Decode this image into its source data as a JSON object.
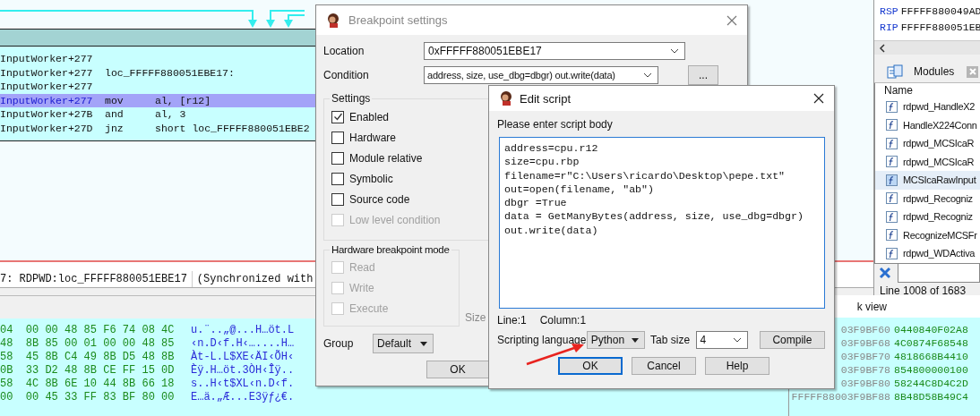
{
  "code_view": {
    "lines": [
      {
        "kind": "blank",
        "address": "InputWorker+277",
        "selected": false
      },
      {
        "kind": "label",
        "address": "InputWorker+277",
        "label": "loc_FFFFF880051EBE17:",
        "selected": false
      },
      {
        "kind": "blank",
        "address": "InputWorker+277",
        "selected": false
      },
      {
        "kind": "instruction",
        "address": "InputWorker+277",
        "mnemonic": "mov",
        "operands": "al, [r12]",
        "selected": true
      },
      {
        "kind": "instruction",
        "address": "InputWorker+27B",
        "mnemonic": "and",
        "operands": "al, 3",
        "selected": false
      },
      {
        "kind": "instruction",
        "address": "InputWorker+27D",
        "mnemonic": "jnz",
        "operands": "short loc_FFFFF880051EBE2",
        "selected": false
      }
    ],
    "status": "7: RDPWD:loc_FFFFF880051EBE17",
    "sync": "(Synchronized with"
  },
  "hex_dump": {
    "rows": [
      {
        "bytes": "04  00 00 48 85 F6 74 08 4C",
        "ascii": "u.¨..„@...H…öt.L"
      },
      {
        "bytes": "48  8B 85 00 01 00 00 48 85",
        "ascii": "‹n.D‹f.H‹…....H…"
      },
      {
        "bytes": "58  45 8B C4 49 8B D5 48 8B",
        "ascii": "Àt-L.L$XE‹ÄI‹ÕH‹"
      },
      {
        "bytes": "0B  33 D2 48 8B CE FF 15 0D",
        "ascii": "Èÿ.H…öt.3ÒH‹Îÿ.."
      },
      {
        "bytes": "58  4C 8B 6E 10 44 8B 66 18",
        "ascii": "s..H‹t$XL‹n.D‹f."
      },
      {
        "bytes": "00  00 45 33 FF 83 BF 80 00",
        "ascii": "E…ä.„Æ...E3ÿƒ¿€."
      }
    ]
  },
  "registers": [
    {
      "name": "RSP",
      "value": "FFFFF880049AD"
    },
    {
      "name": "RIP",
      "value": "FFFFF880051EB"
    }
  ],
  "modules": {
    "tab": "Modules",
    "header": "Name",
    "items": [
      {
        "name": "rdpwd_HandleX2",
        "selected": false
      },
      {
        "name": "HandleX224Conn",
        "selected": false
      },
      {
        "name": "rdpwd_MCSIcaR",
        "selected": false
      },
      {
        "name": "rdpwd_MCSIcaR",
        "selected": false
      },
      {
        "name": "MCSIcaRawInput",
        "selected": true
      },
      {
        "name": "rdpwd_Recogniz",
        "selected": false
      },
      {
        "name": "rdpwd_Recogniz",
        "selected": false
      },
      {
        "name": "RecognizeMCSFr",
        "selected": false
      },
      {
        "name": "rdpwd_WDActiva",
        "selected": false
      }
    ],
    "status": "Line 1008 of 1683"
  },
  "hex_view": {
    "title": "k view",
    "rows": [
      {
        "address": "03F9BF60",
        "data": "0440840F02A8"
      },
      {
        "address": "03F9BF68",
        "data": "4C0874F68548"
      },
      {
        "address": "03F9BF70",
        "data": "4818668B4410"
      },
      {
        "address": "03F9BF78",
        "data": "854800000100"
      },
      {
        "address": "03F9BF80",
        "data": "58244C8D4C2D"
      },
      {
        "address": "FFFFF88003F9BF88",
        "data": "8B48D58B49C4"
      }
    ]
  },
  "breakpoint_dialog": {
    "title": "Breakpoint settings",
    "location": {
      "label": "Location",
      "value": "0xFFFFF880051EBE17"
    },
    "condition": {
      "label": "Condition",
      "value": "address, size, use_dbg=dbgr) out.write(data)",
      "button": "..."
    },
    "settings": {
      "title": "Settings",
      "options": [
        {
          "label": "Enabled",
          "checked": true,
          "disabled": false
        },
        {
          "label": "Hardware",
          "checked": false,
          "disabled": false
        },
        {
          "label": "Module relative",
          "checked": false,
          "disabled": false
        },
        {
          "label": "Symbolic",
          "checked": false,
          "disabled": false
        },
        {
          "label": "Source code",
          "checked": false,
          "disabled": false
        },
        {
          "label": "Low level condition",
          "checked": false,
          "disabled": true
        }
      ]
    },
    "hardware_mode": {
      "title": "Hardware breakpoint mode",
      "options": [
        {
          "label": "Read",
          "checked": false,
          "disabled": true
        },
        {
          "label": "Write",
          "checked": false,
          "disabled": true
        },
        {
          "label": "Execute",
          "checked": false,
          "disabled": true
        }
      ]
    },
    "size_label": "Size",
    "group": {
      "label": "Group",
      "value": "Default"
    },
    "ok": "OK"
  },
  "script_dialog": {
    "title": "Edit script",
    "prompt": "Please enter script body",
    "script": [
      "address=cpu.r12",
      "size=cpu.rbp",
      "filename=r\"C:\\Users\\ricardo\\Desktop\\pepe.txt\"",
      "out=open(filename, \"ab\")",
      "dbgr =True",
      "data = GetManyBytes(address, size, use_dbg=dbgr)",
      "out.write(data)"
    ],
    "line": "Line:1",
    "column": "Column:1",
    "language": {
      "label": "Scripting language",
      "value": "Python"
    },
    "tab_size": {
      "label": "Tab size",
      "value": "4"
    },
    "compile": "Compile",
    "buttons": [
      {
        "label": "OK",
        "focused": true
      },
      {
        "label": "Cancel",
        "focused": false
      },
      {
        "label": "Help",
        "focused": false
      }
    ]
  }
}
